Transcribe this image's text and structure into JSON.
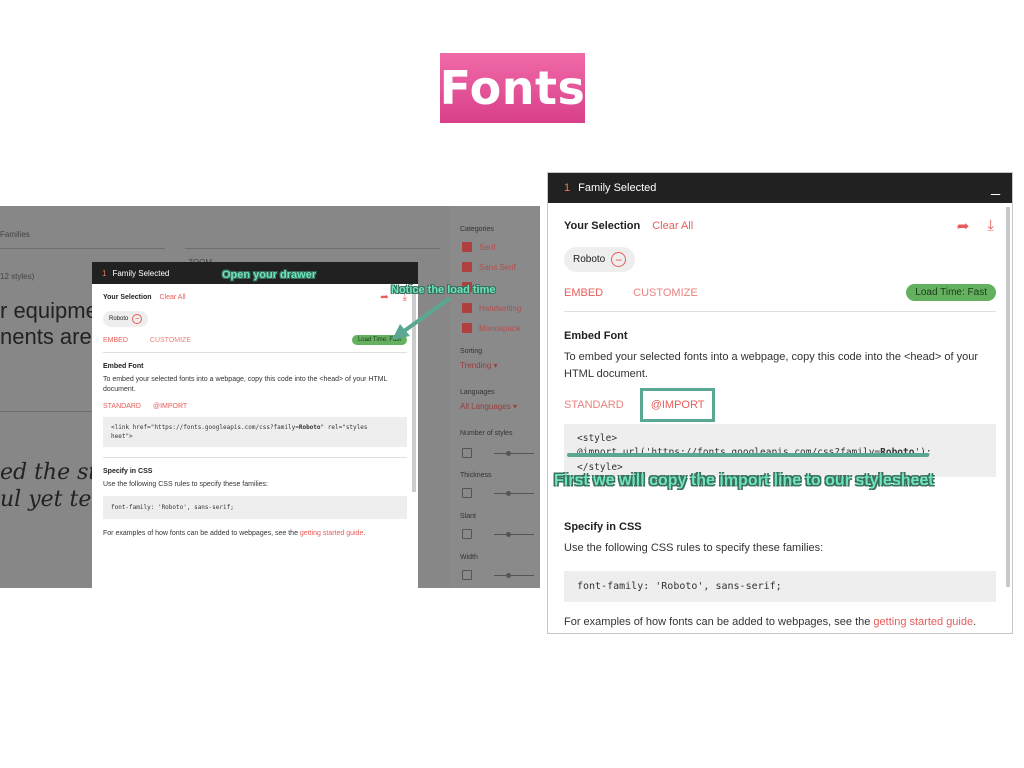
{
  "slide": {
    "title": "Fonts"
  },
  "left": {
    "background": {
      "families_label": "Families",
      "styles_label": "12 styles)",
      "partial_size": "ZOOM",
      "big_line1": "r equipme",
      "big_line2": "nents are a",
      "hand_line1": "ed the st",
      "hand_line2": "ul yet ter"
    },
    "filters": {
      "categories_label": "Categories",
      "categories": [
        "Serif",
        "Sans Serif",
        "Display",
        "Handwriting",
        "Monospace"
      ],
      "sorting_label": "Sorting",
      "sorting_value": "Trending",
      "languages_label": "Languages",
      "languages_value": "All Languages",
      "number_of_styles_label": "Number of styles",
      "thickness_label": "Thickness",
      "slant_label": "Slant",
      "width_label": "Width"
    },
    "drawer": {
      "count": "1",
      "header": "Family Selected",
      "your_selection": "Your Selection",
      "clear_all": "Clear All",
      "chip": "Roboto",
      "tab_embed": "EMBED",
      "tab_customize": "CUSTOMIZE",
      "load_time": "Load Time: Fast",
      "embed_heading": "Embed Font",
      "embed_text": "To embed your selected fonts into a webpage, copy this code into the <head> of your HTML document.",
      "sub_standard": "STANDARD",
      "sub_import": "@IMPORT",
      "code_line1": "<link href=\"https://fonts.googleapis.com/css?family=",
      "code_bold": "Roboto",
      "code_line1_end": "\" rel=\"styles",
      "code_line2": "heet\">",
      "css_heading": "Specify in CSS",
      "css_text": "Use the following CSS rules to specify these families:",
      "css_code": "font-family: 'Roboto', sans-serif;",
      "examples_text": "For examples of how fonts can be added to webpages, see the ",
      "examples_link": "getting started guide",
      "examples_end": "."
    },
    "callouts": {
      "open_drawer": "Open your drawer",
      "load_time": "Notice the load time"
    }
  },
  "right": {
    "drawer": {
      "count": "1",
      "header": "Family Selected",
      "your_selection": "Your Selection",
      "clear_all": "Clear All",
      "chip": "Roboto",
      "tab_embed": "EMBED",
      "tab_customize": "CUSTOMIZE",
      "load_time": "Load Time: Fast",
      "embed_heading": "Embed Font",
      "embed_text": "To embed your selected fonts into a webpage, copy this code into the <head> of your HTML document.",
      "sub_standard": "STANDARD",
      "sub_import": "@IMPORT",
      "code_style_open": "<style>",
      "code_import_start": "@import url('https://fonts.googleapis.com/css?family=",
      "code_import_bold": "Roboto",
      "code_import_end": "');",
      "code_style_close": "</style>",
      "css_heading": "Specify in CSS",
      "css_text": "Use the following CSS rules to specify these families:",
      "css_code": "font-family: 'Roboto', sans-serif;",
      "examples_text": "For examples of how fonts can be added to webpages, see the ",
      "examples_link": "getting started guide",
      "examples_end": "."
    },
    "callout": "First we will copy the import line to our stylesheet"
  },
  "colors": {
    "accent": "#e95c59",
    "load_badge": "#63b05f",
    "annotation": "#5aa894",
    "title_bg": "#e0509a"
  }
}
